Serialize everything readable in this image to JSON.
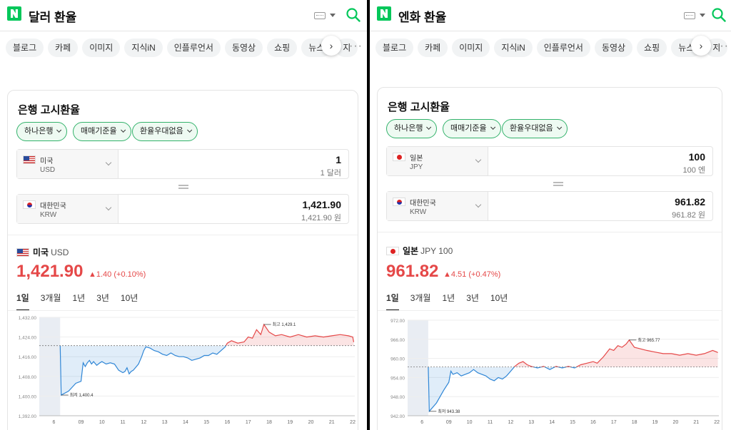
{
  "panels": [
    {
      "id": "left",
      "title": "달러 환율",
      "chips": [
        "블로그",
        "카페",
        "이미지",
        "지식iN",
        "인플루언서",
        "동영상",
        "쇼핑",
        "뉴스",
        "지"
      ],
      "card_title": "은행 고시환율",
      "filters": [
        "하나은행",
        "매매기준율",
        "환율우대없음"
      ],
      "from": {
        "flag": "us",
        "name": "미국",
        "code": "USD",
        "amount": "1",
        "amount_sub": "1 달러"
      },
      "to": {
        "flag": "kr",
        "name": "대한민국",
        "code": "KRW",
        "amount": "1,421.90",
        "amount_sub": "1,421.90 원"
      },
      "rate_country": "미국",
      "rate_code": "USD",
      "rate": "1,421.90",
      "change": "▲1.40 (+0.10%)",
      "tabs": [
        "1일",
        "3개월",
        "1년",
        "3년",
        "10년"
      ],
      "active_tab": 0
    },
    {
      "id": "right",
      "title": "엔화 환율",
      "chips": [
        "블로그",
        "카페",
        "이미지",
        "지식iN",
        "인플루언서",
        "동영상",
        "쇼핑",
        "뉴스",
        "지"
      ],
      "card_title": "은행 고시환율",
      "filters": [
        "하나은행",
        "매매기준율",
        "환율우대없음"
      ],
      "from": {
        "flag": "jp",
        "name": "일본",
        "code": "JPY",
        "amount": "100",
        "amount_sub": "100 엔"
      },
      "to": {
        "flag": "kr",
        "name": "대한민국",
        "code": "KRW",
        "amount": "961.82",
        "amount_sub": "961.82 원"
      },
      "rate_country": "일본",
      "rate_code": "JPY 100",
      "rate": "961.82",
      "change": "▲4.51 (+0.47%)",
      "tabs": [
        "1일",
        "3개월",
        "1년",
        "3년",
        "10년"
      ],
      "active_tab": 0
    }
  ],
  "colors": {
    "up": "#e54848",
    "down": "#2f86d6",
    "brand": "#03c75a",
    "filter_border": "#33b26b"
  },
  "chart_data": [
    {
      "type": "area",
      "yticks": [
        "1,432.00",
        "1,424.00",
        "1,416.00",
        "1,408.00",
        "1,400.00",
        "1,392.00"
      ],
      "ytick_values": [
        1432,
        1424,
        1416,
        1408,
        1400,
        1392
      ],
      "xticks": [
        "6",
        "09",
        "10",
        "11",
        "12",
        "13",
        "14",
        "15",
        "16",
        "17",
        "18",
        "19",
        "20",
        "21",
        "22"
      ],
      "ylim": [
        1392,
        1432
      ],
      "xlim": [
        7,
        22.1
      ],
      "baseline": 1420.5,
      "x": [
        8.0,
        8.02,
        8.05,
        8.4,
        8.75,
        9.0,
        9.1,
        9.2,
        9.3,
        9.4,
        9.5,
        9.6,
        9.75,
        9.9,
        10.0,
        10.2,
        10.4,
        10.6,
        10.8,
        11.0,
        11.1,
        11.2,
        11.3,
        11.4,
        11.5,
        11.6,
        11.75,
        11.9,
        12.0,
        12.1,
        12.3,
        12.5,
        12.7,
        12.9,
        13.1,
        13.3,
        13.5,
        13.7,
        13.9,
        14.1,
        14.3,
        14.5,
        14.7,
        14.9,
        15.1,
        15.3,
        15.5,
        15.7,
        15.9,
        16.0,
        16.2,
        16.5,
        16.8,
        17.0,
        17.2,
        17.4,
        17.6,
        17.75,
        18.0,
        18.3,
        18.6,
        19.0,
        19.4,
        19.8,
        20.2,
        20.6,
        21.0,
        21.4,
        21.8,
        22.0,
        22.05
      ],
      "values": [
        1420.5,
        1412.0,
        1400.4,
        1402.0,
        1405.2,
        1406.0,
        1413.5,
        1412.0,
        1413.5,
        1414.5,
        1413.0,
        1414.0,
        1412.5,
        1413.5,
        1414.0,
        1413.0,
        1413.5,
        1413.0,
        1410.5,
        1409.5,
        1410.0,
        1411.5,
        1409.0,
        1410.0,
        1410.5,
        1411.5,
        1413.0,
        1416.0,
        1418.5,
        1420.0,
        1419.5,
        1418.5,
        1418.0,
        1417.0,
        1416.5,
        1417.5,
        1416.5,
        1416.0,
        1416.0,
        1415.5,
        1414.5,
        1415.0,
        1415.5,
        1416.5,
        1416.5,
        1417.5,
        1417.0,
        1418.5,
        1420.0,
        1421.5,
        1422.5,
        1421.5,
        1422.0,
        1424.0,
        1423.5,
        1427.0,
        1425.0,
        1429.1,
        1426.0,
        1424.5,
        1425.0,
        1424.0,
        1425.0,
        1424.0,
        1424.5,
        1424.0,
        1424.5,
        1425.0,
        1424.5,
        1424.0,
        1421.9
      ],
      "high": {
        "label": "최고 1,429.1",
        "x": 17.75,
        "y": 1429.1
      },
      "low": {
        "label": "최저 1,400.4",
        "x": 8.05,
        "y": 1400.4
      }
    },
    {
      "type": "area",
      "yticks": [
        "972.00",
        "966.00",
        "960.00",
        "954.00",
        "948.00",
        "942.00"
      ],
      "ytick_values": [
        972,
        966,
        960,
        954,
        948,
        942
      ],
      "xticks": [
        "6",
        "09",
        "10",
        "11",
        "12",
        "13",
        "14",
        "15",
        "16",
        "17",
        "18",
        "19",
        "20",
        "21",
        "22"
      ],
      "ylim": [
        942,
        972
      ],
      "xlim": [
        7,
        22.1
      ],
      "baseline": 957.3,
      "x": [
        8.0,
        8.02,
        8.05,
        8.4,
        8.75,
        9.0,
        9.1,
        9.2,
        9.4,
        9.6,
        9.8,
        10.0,
        10.2,
        10.4,
        10.6,
        10.8,
        11.0,
        11.2,
        11.4,
        11.6,
        11.8,
        12.0,
        12.2,
        12.4,
        12.6,
        12.8,
        13.0,
        13.3,
        13.6,
        13.9,
        14.2,
        14.5,
        14.8,
        15.1,
        15.4,
        15.7,
        16.0,
        16.2,
        16.5,
        16.8,
        17.0,
        17.2,
        17.4,
        17.6,
        17.75,
        18.0,
        18.3,
        18.6,
        19.0,
        19.4,
        19.8,
        20.2,
        20.6,
        21.0,
        21.4,
        21.8,
        22.0,
        22.05
      ],
      "values": [
        957.3,
        952.0,
        943.38,
        946.0,
        950.0,
        952.5,
        956.0,
        955.0,
        955.5,
        954.5,
        955.0,
        955.5,
        956.5,
        955.5,
        955.0,
        954.5,
        953.5,
        953.0,
        954.0,
        953.5,
        954.5,
        956.0,
        957.5,
        958.5,
        959.0,
        958.0,
        957.5,
        957.0,
        957.5,
        956.5,
        957.5,
        957.0,
        957.5,
        957.0,
        958.0,
        958.5,
        959.0,
        958.5,
        960.5,
        963.0,
        962.5,
        964.0,
        963.5,
        964.5,
        965.77,
        963.5,
        963.0,
        962.5,
        962.0,
        961.5,
        961.5,
        961.0,
        961.5,
        961.0,
        961.5,
        962.5,
        962.0,
        961.82
      ],
      "high": {
        "label": "최고 965.77",
        "x": 17.75,
        "y": 965.77
      },
      "low": {
        "label": "최저 943.38",
        "x": 8.05,
        "y": 943.38
      }
    }
  ]
}
